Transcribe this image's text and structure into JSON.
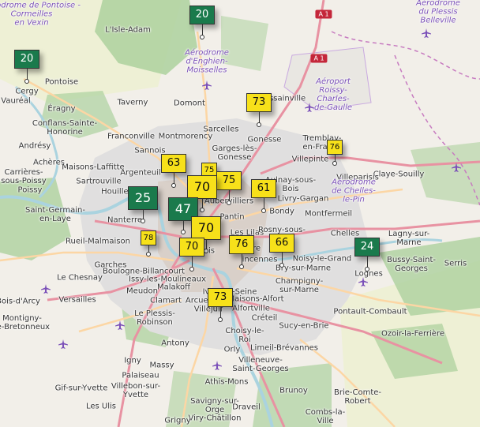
{
  "colors": {
    "yellow_marker": "#f7e11a",
    "green_marker": "#1a7a4c",
    "motorway": "#e892a2",
    "primary": "#fcd6a4",
    "forest": "#add19e",
    "urban": "#e0dfdf",
    "water": "#aad3df",
    "airport": "#7a4fb8"
  },
  "road_shields": [
    {
      "id": "a1-top",
      "label": "A 1"
    },
    {
      "id": "a1-mid",
      "label": "A 1"
    }
  ],
  "places": [
    {
      "id": "isle-adam",
      "text": "L'Isle-Adam"
    },
    {
      "id": "cergy",
      "text": "Cergy"
    },
    {
      "id": "pontoise",
      "text": "Pontoise"
    },
    {
      "id": "vaureal",
      "text": "Vauréal"
    },
    {
      "id": "eragny",
      "text": "Éragny"
    },
    {
      "id": "taverny",
      "text": "Taverny"
    },
    {
      "id": "domont",
      "text": "Domont"
    },
    {
      "id": "goussainville",
      "text": "Goussainville"
    },
    {
      "id": "conflans",
      "text": "Conflans-Sainte-\nHonorine"
    },
    {
      "id": "franconville",
      "text": "Franconville"
    },
    {
      "id": "montmorency",
      "text": "Montmorency"
    },
    {
      "id": "sarcelles",
      "text": "Sarcelles"
    },
    {
      "id": "gonesse",
      "text": "Gonesse"
    },
    {
      "id": "tremblay",
      "text": "Tremblay-\nen-France"
    },
    {
      "id": "andresy",
      "text": "Andrésy"
    },
    {
      "id": "sannois",
      "text": "Sannois"
    },
    {
      "id": "garges",
      "text": "Garges-lès-\nGonesse"
    },
    {
      "id": "villepinte",
      "text": "Villepinte"
    },
    {
      "id": "acheres",
      "text": "Achères"
    },
    {
      "id": "maisons-laffitte",
      "text": "Maisons-Laffitte"
    },
    {
      "id": "argenteuil",
      "text": "Argenteuil"
    },
    {
      "id": "saint-denis",
      "text": "Saint-D"
    },
    {
      "id": "aulnay",
      "text": "Aulnay-sous-\nBois"
    },
    {
      "id": "claye",
      "text": "Claye-Souilly"
    },
    {
      "id": "carrieres",
      "text": "Carrières-\nsous-Poissy"
    },
    {
      "id": "sartrouville",
      "text": "Sartrouville"
    },
    {
      "id": "livry",
      "text": "Livry-Gargan"
    },
    {
      "id": "villeparisis",
      "text": "Villeparisis"
    },
    {
      "id": "poissy",
      "text": "Poissy"
    },
    {
      "id": "houilles",
      "text": "Houilles"
    },
    {
      "id": "aubervilliers",
      "text": "Aubervilliers"
    },
    {
      "id": "bondy",
      "text": "Bondy"
    },
    {
      "id": "montfermeil",
      "text": "Montfermeil"
    },
    {
      "id": "saint-germain",
      "text": "Saint-Germain-\nen-Laye"
    },
    {
      "id": "nanterre",
      "text": "Nanterre"
    },
    {
      "id": "pantin",
      "text": "Pantin"
    },
    {
      "id": "chelles",
      "text": "Chelles"
    },
    {
      "id": "lagny",
      "text": "Lagny-sur-\nMarne"
    },
    {
      "id": "les-lilas",
      "text": "Les Lilas"
    },
    {
      "id": "rosny",
      "text": "Rosny-sous-\nBois"
    },
    {
      "id": "rueil",
      "text": "Rueil-Malmaison"
    },
    {
      "id": "paris",
      "text": "is"
    },
    {
      "id": "montreuil",
      "text": "ntre"
    },
    {
      "id": "noisy",
      "text": "Noisy-le-Grand"
    },
    {
      "id": "bussy",
      "text": "Bussy-Saint-\nGeorges"
    },
    {
      "id": "serris",
      "text": "Serris"
    },
    {
      "id": "garches",
      "text": "Garches"
    },
    {
      "id": "vincennes",
      "text": "incennes"
    },
    {
      "id": "bry",
      "text": "Bry-sur-Marne"
    },
    {
      "id": "lognes",
      "text": "Lognes"
    },
    {
      "id": "chesnay",
      "text": "Le Chesnay"
    },
    {
      "id": "boulogne",
      "text": "Boulogne-Billancourt"
    },
    {
      "id": "issy",
      "text": "Issy-les-Moulineaux"
    },
    {
      "id": "malakoff",
      "text": "Malakoff"
    },
    {
      "id": "champigny",
      "text": "Champigny-\nsur-Marne"
    },
    {
      "id": "versailles",
      "text": "Versailles"
    },
    {
      "id": "meudon",
      "text": "Meudon"
    },
    {
      "id": "clamart",
      "text": "Clamart"
    },
    {
      "id": "arcueil",
      "text": "Arcueil"
    },
    {
      "id": "ivry",
      "text": "Ivry-sur-Seine"
    },
    {
      "id": "maisons-alfort",
      "text": "Maisons-Alfort"
    },
    {
      "id": "villejuif",
      "text": "Villejuif"
    },
    {
      "id": "alfortville",
      "text": "Alfortville"
    },
    {
      "id": "bois-arcy",
      "text": "Bois-d'Arcy"
    },
    {
      "id": "plessis",
      "text": "Le Plessis-\nRobinson"
    },
    {
      "id": "creteil",
      "text": "Créteil"
    },
    {
      "id": "sucy",
      "text": "Sucy-en-Brie"
    },
    {
      "id": "pontault",
      "text": "Pontault-Combault"
    },
    {
      "id": "montigny",
      "text": "Montigny-\nle-Bretonneux"
    },
    {
      "id": "choisy",
      "text": "Choisy-le-\nRoi"
    },
    {
      "id": "ozoir",
      "text": "Ozoir-la-Ferrière"
    },
    {
      "id": "antony",
      "text": "Antony"
    },
    {
      "id": "orly",
      "text": "Orly"
    },
    {
      "id": "limeil",
      "text": "Limeil-Brévannes"
    },
    {
      "id": "villeneuve",
      "text": "Villeneuve-\nSaint-Georges"
    },
    {
      "id": "igny",
      "text": "Igny"
    },
    {
      "id": "massy",
      "text": "Massy"
    },
    {
      "id": "palaiseau",
      "text": "Palaiseau"
    },
    {
      "id": "athis",
      "text": "Athis-Mons"
    },
    {
      "id": "brunoy",
      "text": "Brunoy"
    },
    {
      "id": "gif",
      "text": "Gif-sur-Yvette"
    },
    {
      "id": "villebon",
      "text": "Villebon-sur-\nYvette"
    },
    {
      "id": "brie",
      "text": "Brie-Comte-\nRobert"
    },
    {
      "id": "les-ulis",
      "text": "Les Ulis"
    },
    {
      "id": "savigny",
      "text": "Savigny-sur-\nOrge"
    },
    {
      "id": "draveil",
      "text": "Draveil"
    },
    {
      "id": "viry",
      "text": "Viry-Châtillon"
    },
    {
      "id": "combs",
      "text": "Combs-la-\nVille"
    },
    {
      "id": "grigny",
      "text": "Grigny"
    }
  ],
  "airport_labels": [
    {
      "id": "pontoise-airport",
      "text": "Aérodrome de Pontoise -\nCormeilles\nen Vexin"
    },
    {
      "id": "plessis-belleville",
      "text": "Aérodrome\ndu Plessis\nBelleville"
    },
    {
      "id": "enghien",
      "text": "Aérodrome\nd'Enghien-\nMoisselles"
    },
    {
      "id": "cdg",
      "text": "Aéroport\nRoissy-\nCharles-\nde-Gaulle"
    },
    {
      "id": "chelles-airfield",
      "text": "Aérodrome\nde Chelles-\nle-Pin"
    }
  ],
  "markers": [
    {
      "id": "m-isle-adam",
      "value": "20",
      "level": "green",
      "size": "medium"
    },
    {
      "id": "m-cergy",
      "value": "20",
      "level": "green",
      "size": "medium"
    },
    {
      "id": "m-gonesse",
      "value": "73",
      "level": "yellow",
      "size": "medium"
    },
    {
      "id": "m-villepinte",
      "value": "76",
      "level": "yellow",
      "size": "small"
    },
    {
      "id": "m-argenteuil",
      "value": "63",
      "level": "yellow",
      "size": "medium"
    },
    {
      "id": "m-saint-denis",
      "value": "75",
      "level": "yellow",
      "size": "small"
    },
    {
      "id": "m-aubervilliers",
      "value": "75",
      "level": "yellow",
      "size": "medium"
    },
    {
      "id": "m-bondy",
      "value": "61",
      "level": "yellow",
      "size": "medium"
    },
    {
      "id": "m-nanterre",
      "value": "25",
      "level": "green",
      "size": "large"
    },
    {
      "id": "m-clichy",
      "value": "70",
      "level": "yellow",
      "size": "large"
    },
    {
      "id": "m-levallois",
      "value": "47",
      "level": "green",
      "size": "large"
    },
    {
      "id": "m-paris-center",
      "value": "70",
      "level": "yellow",
      "size": "large"
    },
    {
      "id": "m-rueil",
      "value": "78",
      "level": "yellow",
      "size": "small"
    },
    {
      "id": "m-vincennes",
      "value": "76",
      "level": "yellow",
      "size": "medium"
    },
    {
      "id": "m-rosny",
      "value": "66",
      "level": "yellow",
      "size": "medium"
    },
    {
      "id": "m-lognes",
      "value": "24",
      "level": "green",
      "size": "medium"
    },
    {
      "id": "m-paris-south",
      "value": "70",
      "level": "yellow",
      "size": "medium"
    },
    {
      "id": "m-villejuif",
      "value": "73",
      "level": "yellow",
      "size": "medium"
    }
  ]
}
